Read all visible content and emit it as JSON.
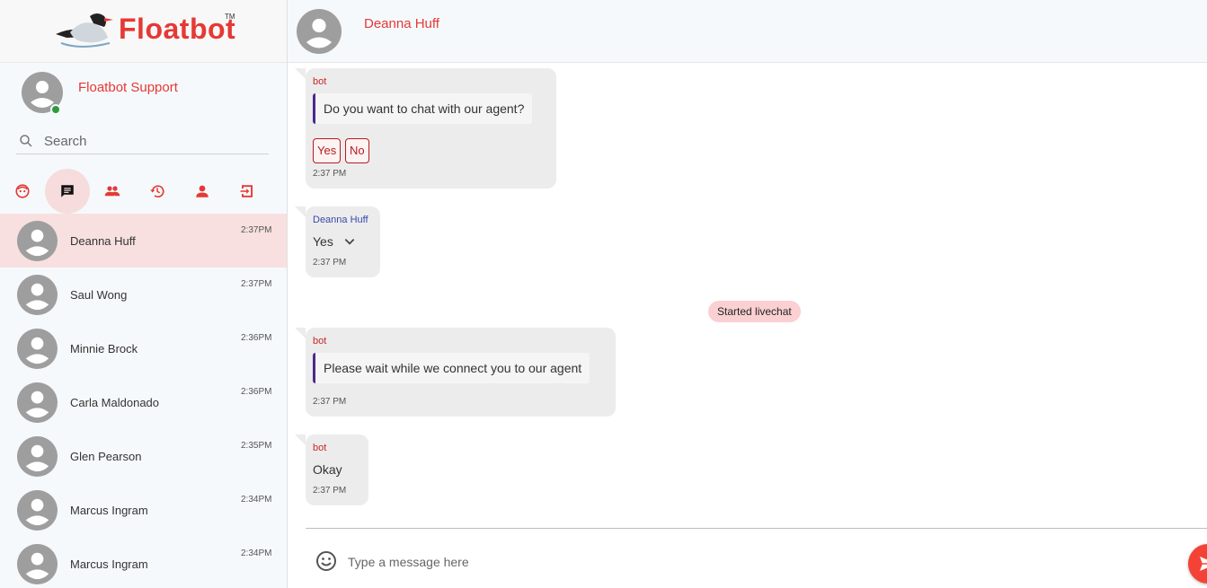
{
  "brand": {
    "name": "Floatbot",
    "tm": "TM"
  },
  "agent": {
    "name": "Floatbot Support",
    "status": "online"
  },
  "search": {
    "placeholder": "Search"
  },
  "tabs": [
    {
      "icon": "bot-face-icon",
      "active": false
    },
    {
      "icon": "chat-icon",
      "active": true
    },
    {
      "icon": "group-icon",
      "active": false
    },
    {
      "icon": "history-icon",
      "active": false
    },
    {
      "icon": "person-icon",
      "active": false
    },
    {
      "icon": "logout-icon",
      "active": false
    }
  ],
  "chats": [
    {
      "name": "Deanna Huff",
      "time": "2:37PM",
      "active": true
    },
    {
      "name": "Saul Wong",
      "time": "2:37PM",
      "active": false
    },
    {
      "name": "Minnie Brock",
      "time": "2:36PM",
      "active": false
    },
    {
      "name": "Carla Maldonado",
      "time": "2:36PM",
      "active": false
    },
    {
      "name": "Glen Pearson",
      "time": "2:35PM",
      "active": false
    },
    {
      "name": "Marcus Ingram",
      "time": "2:34PM",
      "active": false
    },
    {
      "name": "Marcus Ingram",
      "time": "2:34PM",
      "active": false
    }
  ],
  "conversation": {
    "title": "Deanna Huff",
    "messages": [
      {
        "sender": "bot",
        "text": "Do you want to chat with our agent?",
        "options": [
          "Yes",
          "No"
        ],
        "time": "2:37 PM"
      },
      {
        "sender": "Deanna Huff",
        "text": "Yes",
        "time": "2:37 PM"
      },
      {
        "system": "Started livechat"
      },
      {
        "sender": "bot",
        "text": "Please wait while we connect you to our agent",
        "time": "2:37 PM"
      },
      {
        "sender": "bot",
        "text": "Okay",
        "time": "2:37 PM"
      }
    ]
  },
  "composer": {
    "placeholder": "Type a message here"
  },
  "colors": {
    "accent": "#e53935",
    "active_row": "#f8e0e0",
    "sidebar_bg": "#f6f9fc",
    "bubble_bg": "#ececec",
    "online": "#2e9a3c",
    "quote_bar": "#4a2a8c"
  }
}
